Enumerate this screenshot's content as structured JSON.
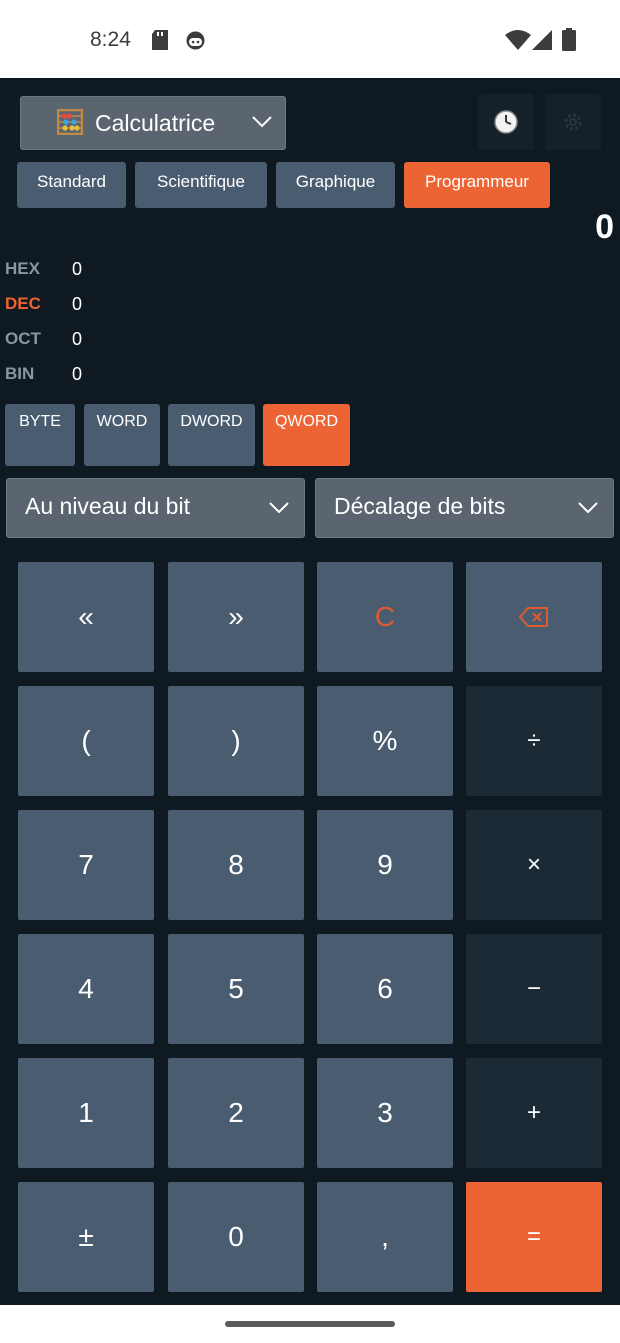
{
  "status": {
    "time": "8:24"
  },
  "header": {
    "mode_label": "Calculatrice",
    "history_icon": "clock-icon",
    "settings_icon": "gear-icon"
  },
  "tabs": [
    {
      "label": "Standard",
      "active": false
    },
    {
      "label": "Scientifique",
      "active": false
    },
    {
      "label": "Graphique",
      "active": false
    },
    {
      "label": "Programmeur",
      "active": true
    }
  ],
  "display": {
    "value": "0"
  },
  "radix": [
    {
      "label": "HEX",
      "value": "0",
      "active": false
    },
    {
      "label": "DEC",
      "value": "0",
      "active": true
    },
    {
      "label": "OCT",
      "value": "0",
      "active": false
    },
    {
      "label": "BIN",
      "value": "0",
      "active": false
    }
  ],
  "word_sizes": [
    {
      "label": "BYTE",
      "active": false
    },
    {
      "label": "WORD",
      "active": false
    },
    {
      "label": "DWORD",
      "active": false
    },
    {
      "label": "QWORD",
      "active": true
    }
  ],
  "dropdowns": {
    "bitwise": "Au niveau du bit",
    "bitshift": "Décalage de bits"
  },
  "keys": [
    [
      "«",
      "»",
      "C",
      "⌫"
    ],
    [
      "(",
      ")",
      "%",
      "÷"
    ],
    [
      "7",
      "8",
      "9",
      "×"
    ],
    [
      "4",
      "5",
      "6",
      "−"
    ],
    [
      "1",
      "2",
      "3",
      "+"
    ],
    [
      "±",
      "0",
      ",",
      "="
    ]
  ],
  "colors": {
    "accent": "#ec6433",
    "background": "#0f1922",
    "key": "#4a5d70",
    "operator_key": "#1c2a36"
  }
}
